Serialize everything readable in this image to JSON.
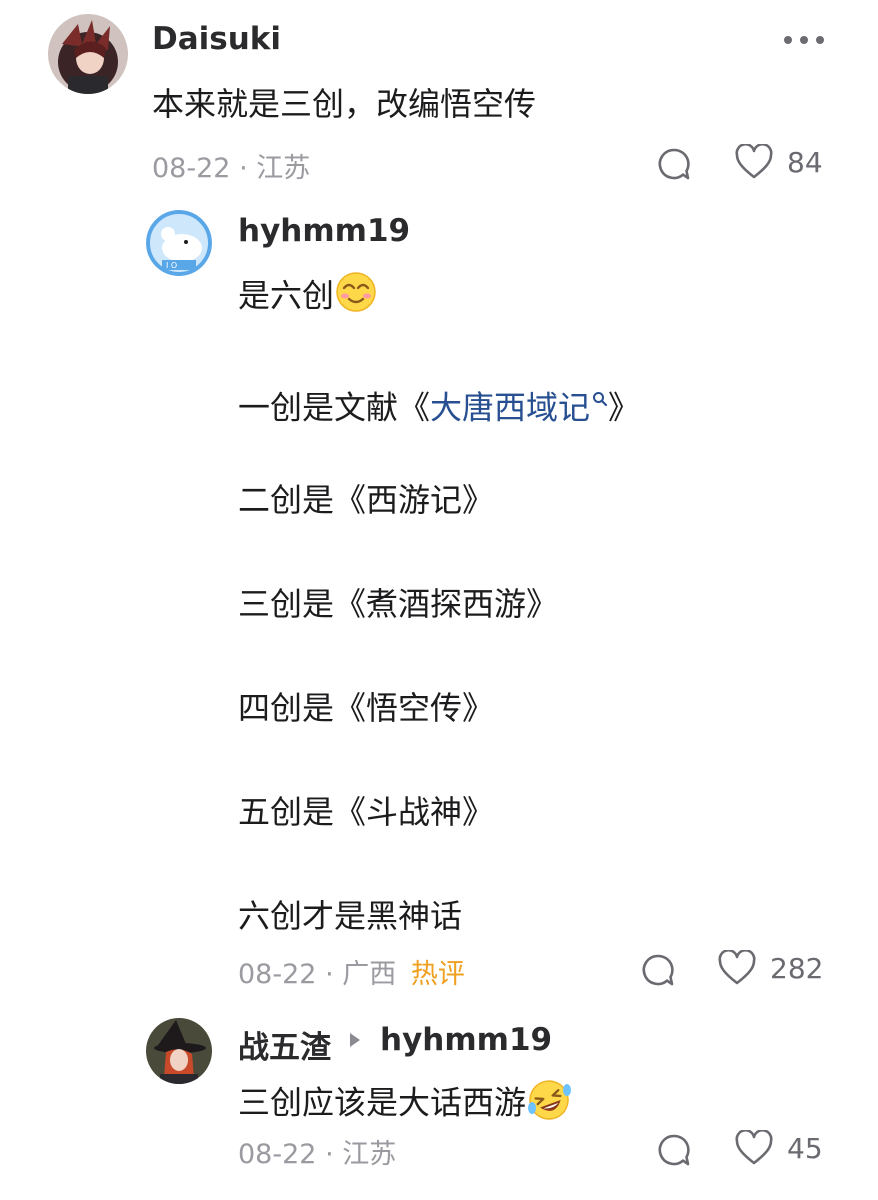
{
  "comments": {
    "main": {
      "username": "Daisuki",
      "text": "本来就是三创，改编悟空传",
      "date": "08-22",
      "location": "江苏",
      "likes": "84",
      "avatar_icon": "anime-avatar-icon"
    },
    "reply1": {
      "username": "hyhmm19",
      "lines": {
        "l0": "是六创",
        "l1_prefix": "一创是文献《",
        "l1_link": "大唐西域记",
        "l1_suffix": "》",
        "l2": "二创是《西游记》",
        "l3": "三创是《煮酒探西游》",
        "l4": "四创是《悟空传》",
        "l5": "五创是《斗战神》",
        "l6": "六创才是黑神话"
      },
      "date": "08-22",
      "location": "广西",
      "badge": "热评",
      "likes": "282",
      "avatar_icon": "polar-bear-avatar-icon"
    },
    "reply2": {
      "username": "战五渣",
      "reply_to": "hyhmm19",
      "text": "三创应该是大话西游",
      "date": "08-22",
      "location": "江苏",
      "likes": "45",
      "avatar_icon": "witch-avatar-icon"
    }
  },
  "colors": {
    "link": "#274f91",
    "hot_badge": "#f0a020",
    "meta": "#9a9aa0"
  }
}
